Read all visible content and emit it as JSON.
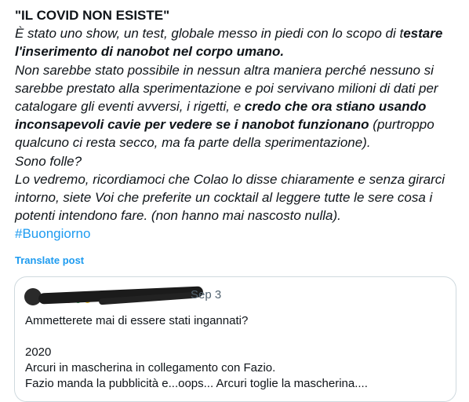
{
  "post": {
    "headline": "\"IL COVID NON ESISTE\"",
    "p1_regular": "È stato uno show, un test, globale messo in piedi con lo scopo di t",
    "p1_bold": "estare l'inserimento di nanobot nel corpo umano.",
    "p2_regular": "Non sarebbe stato possibile in nessun altra maniera perché nessuno si sarebbe prestato alla sperimentazione e poi servivano milioni di dati per catalogare gli eventi avversi, i rigetti, e ",
    "p2_bold": "credo che ora stiano usando inconsapevoli cavie per vedere se i nanobot funzionano",
    "p2_tail": " (purtroppo qualcuno ci resta secco, ma fa parte della sperimentazione).",
    "p3": "Sono folle?",
    "p4": "Lo vedremo, ricordiamoci che Colao lo disse chiaramente e senza girarci intorno, siete Voi che preferite un cocktail al leggere tutte le sere cosa i potenti intendono fare. (non hanno mai nascosto nulla).",
    "hashtag": "#Buongiorno",
    "translate_label": "Translate post"
  },
  "quoted": {
    "date": "Sep 3",
    "line1": "Ammetterete mai di essere stati ingannati?",
    "line2": "2020",
    "line3": "Arcuri in mascherina in collegamento con Fazio.",
    "line4": "Fazio manda la pubblicità e...oops... Arcuri toglie la mascherina...."
  },
  "colors": {
    "link": "#1d9bf0",
    "text": "#0f1419",
    "muted": "#536471",
    "border": "#cfd9de"
  }
}
